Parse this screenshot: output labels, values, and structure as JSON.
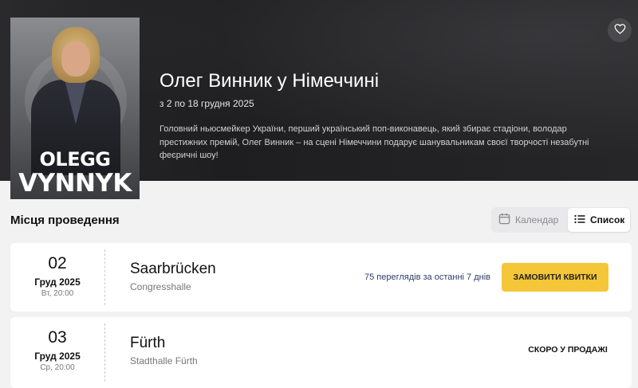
{
  "event": {
    "title": "Олег Винник у Німеччині",
    "dates": "з 2 по 18 грудня 2025",
    "description": "Головний ньюсмейкер України, перший український поп-виконавець, який збирає стадіони, володар престижних премій, Олег Винник – на сцені Німеччини подарує шанувальникам своєї творчості незабутні феєричні шоу!",
    "poster": {
      "line1": "OLEGG",
      "line2": "VYNNYK"
    }
  },
  "venues": {
    "heading": "Місця проведення",
    "view_toggle": {
      "calendar_label": "Календар",
      "list_label": "Список",
      "active": "list"
    },
    "items": [
      {
        "day": "02",
        "month_year": "Груд 2025",
        "weekday_time": "Вт, 20:00",
        "city": "Saarbrücken",
        "hall": "Congresshalle",
        "views": "75 переглядів за останні 7 днів",
        "action": "ЗАМОВИТИ КВИТКИ"
      },
      {
        "day": "03",
        "month_year": "Груд 2025",
        "weekday_time": "Ср, 20:00",
        "city": "Fürth",
        "hall": "Stadthalle Fürth",
        "status": "СКОРО У ПРОДАЖІ"
      }
    ]
  },
  "colors": {
    "accent": "#f5c638",
    "hero_bg": "#242426",
    "page_bg": "#f2f2f3"
  }
}
